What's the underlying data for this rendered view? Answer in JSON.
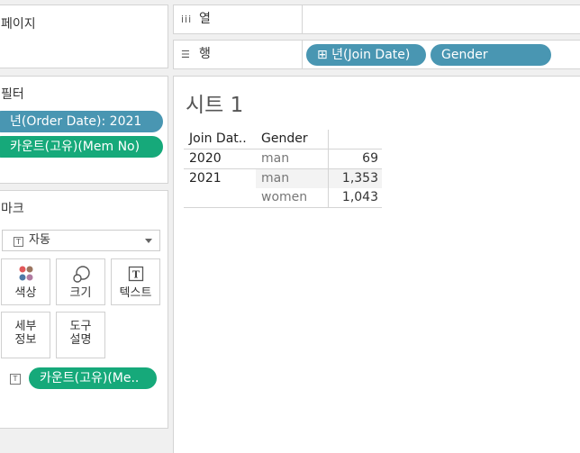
{
  "left": {
    "pages_title": "페이지",
    "filters_title": "필터",
    "filters": [
      {
        "label": "년(Order Date): 2021",
        "color": "#4996b2"
      },
      {
        "label": "카운트(고유)(Mem No)",
        "color": "#16a97a"
      }
    ],
    "marks_title": "마크",
    "mark_type": "자동",
    "mark_buttons": [
      {
        "label": "색상",
        "icon": "color-dots-icon"
      },
      {
        "label": "크기",
        "icon": "size-circles-icon"
      },
      {
        "label": "텍스트",
        "icon": "text-t-icon"
      },
      {
        "label_line1": "세부",
        "label_line2": "정보",
        "icon": "detail-icon"
      },
      {
        "label_line1": "도구",
        "label_line2": "설명",
        "icon": "tooltip-icon"
      }
    ],
    "text_mark_field": "카운트(고유)(Me.."
  },
  "shelves": {
    "columns_label": "열",
    "rows_label": "행",
    "row_pills": [
      {
        "label": "⊞ 년(Join Date)"
      },
      {
        "label": "Gender"
      }
    ]
  },
  "sheet": {
    "title": "시트 1",
    "headers": {
      "join_date": "Join Dat..",
      "gender": "Gender"
    },
    "rows": [
      {
        "year": "2020",
        "gender": "man",
        "value": "69"
      },
      {
        "year": "2021",
        "gender": "man",
        "value": "1,353"
      },
      {
        "year": "",
        "gender": "women",
        "value": "1,043"
      }
    ]
  },
  "colors": {
    "pill_blue": "#4996b2",
    "pill_green": "#16a97a"
  }
}
